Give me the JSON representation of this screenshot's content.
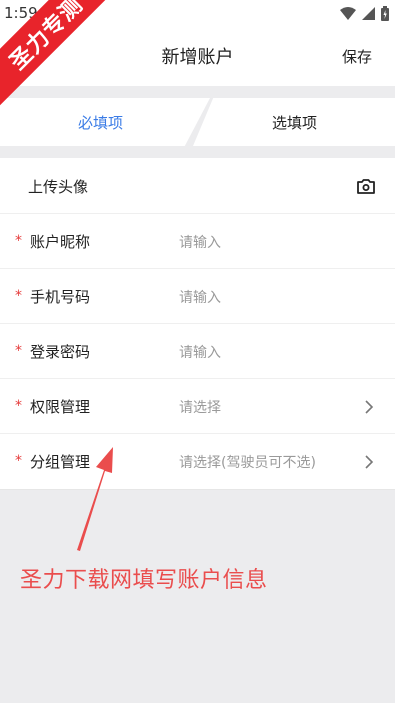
{
  "statusbar": {
    "time": "1:59"
  },
  "watermark": {
    "ribbon_text": "圣力专测"
  },
  "navbar": {
    "title": "新增账户",
    "save_label": "保存"
  },
  "tabs": [
    {
      "label": "必填项",
      "active": true
    },
    {
      "label": "选填项",
      "active": false
    }
  ],
  "form": {
    "avatar_label": "上传头像",
    "required_mark": "*",
    "rows": [
      {
        "label": "账户昵称",
        "placeholder": "请输入",
        "required": true,
        "chevron": false
      },
      {
        "label": "手机号码",
        "placeholder": "请输入",
        "required": true,
        "chevron": false
      },
      {
        "label": "登录密码",
        "placeholder": "请输入",
        "required": true,
        "chevron": false
      },
      {
        "label": "权限管理",
        "placeholder": "请选择",
        "required": true,
        "chevron": true
      },
      {
        "label": "分组管理",
        "placeholder": "请选择(驾驶员可不选)",
        "required": true,
        "chevron": true
      }
    ]
  },
  "annotation": {
    "text": "圣力下载网填写账户信息"
  },
  "colors": {
    "accent": "#3b7ce6",
    "required": "#e53a3a",
    "annotation": "#ea4d4d",
    "ribbon": "#e8242b"
  }
}
